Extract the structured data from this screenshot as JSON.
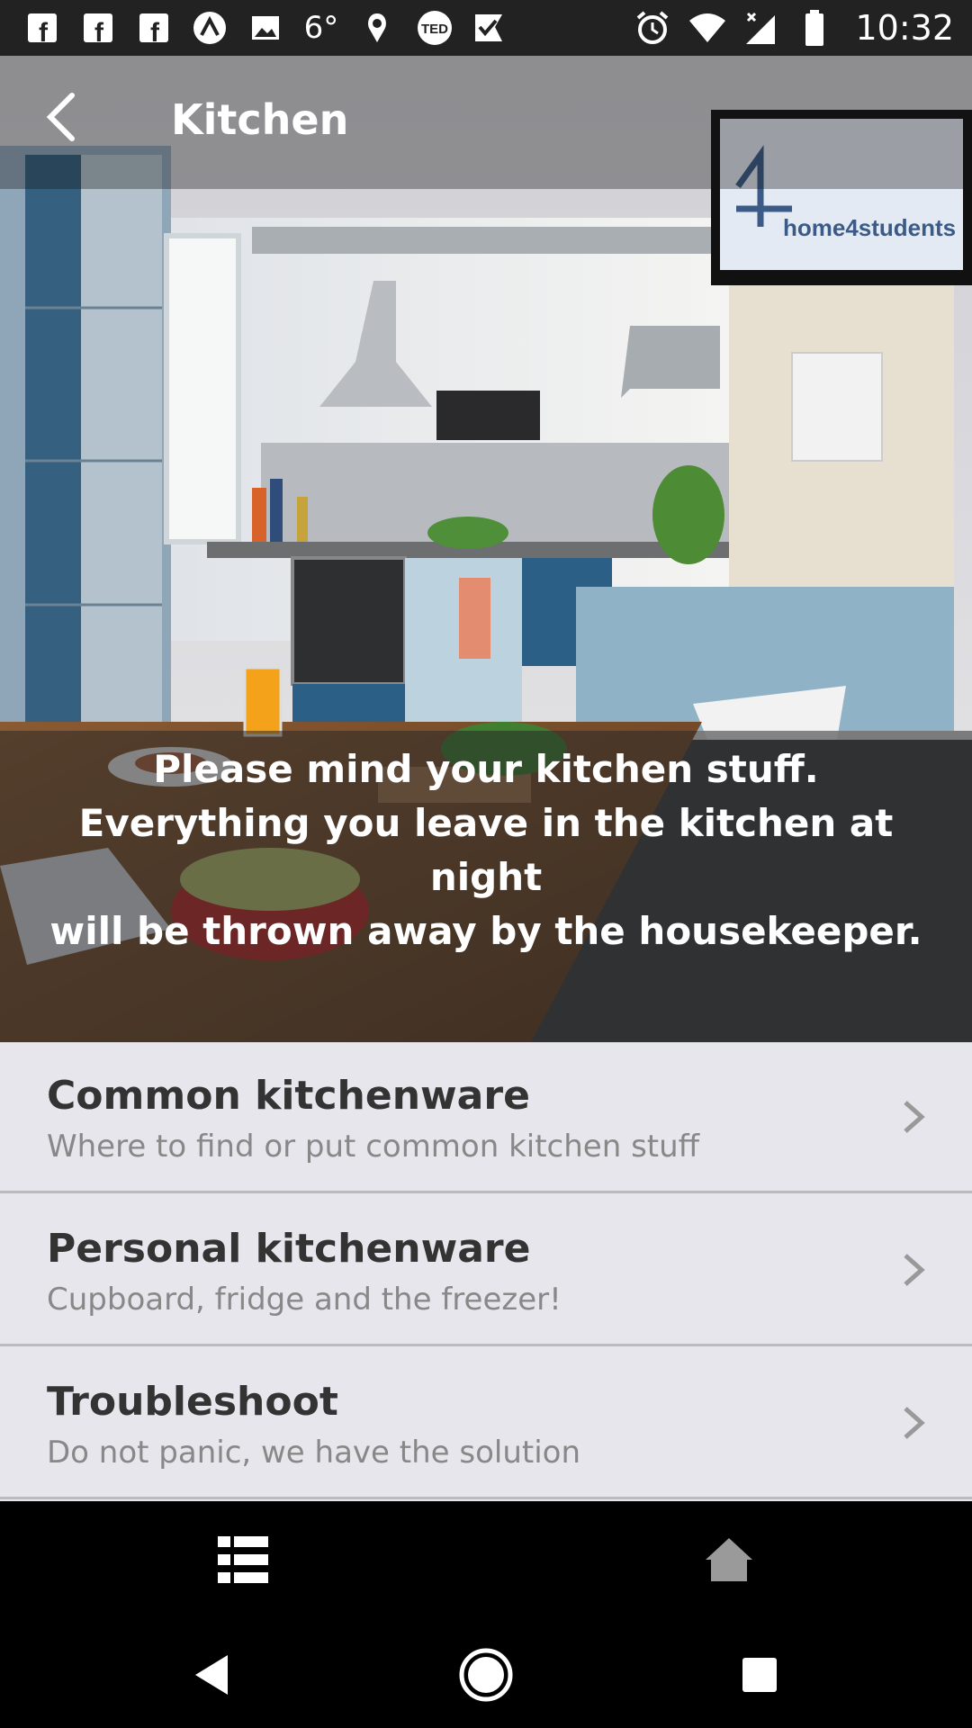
{
  "status_bar": {
    "temperature": "6°",
    "time": "10:32",
    "left_icons": [
      "facebook-icon",
      "facebook-icon",
      "facebook-icon",
      "arrow-circle-icon",
      "image-icon",
      "weather-icon",
      "location-leaf-icon",
      "ted-icon",
      "checkmark-flag-icon"
    ],
    "right_icons": [
      "alarm-icon",
      "wifi-icon",
      "signal-icon",
      "battery-icon"
    ]
  },
  "app_bar": {
    "title": "Kitchen"
  },
  "hero": {
    "tv_brand": "home4students",
    "notice": "Please mind your kitchen stuff.\nEverything you leave in the kitchen at night\nwill be thrown away by the housekeeper."
  },
  "list": {
    "items": [
      {
        "title": "Common kitchenware",
        "subtitle": "Where to find or put common kitchen stuff"
      },
      {
        "title": "Personal kitchenware",
        "subtitle": "Cupboard, fridge and the freezer!"
      },
      {
        "title": "Troubleshoot",
        "subtitle": "Do not panic, we have the solution"
      }
    ]
  },
  "bottom_nav": {
    "icons": [
      "list-icon",
      "home-icon"
    ]
  },
  "system_nav": {
    "icons": [
      "back-triangle-icon",
      "home-circle-icon",
      "recents-square-icon"
    ]
  },
  "colors": {
    "status_bar": "#222222",
    "list_bg": "#e6e6ec",
    "nav_bg": "#000000"
  }
}
